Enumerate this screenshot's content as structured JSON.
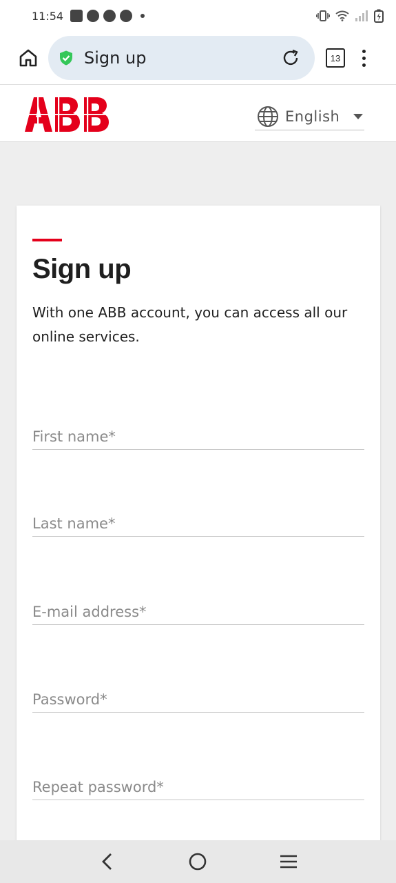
{
  "status_bar": {
    "time": "11:54",
    "icons": [
      "mail-icon",
      "speed-icon",
      "speed-icon",
      "speed-icon",
      "dot-icon",
      "vibrate-icon",
      "wifi-icon",
      "signal-icon",
      "battery-charging-icon"
    ]
  },
  "browser": {
    "tab_title": "Sign up",
    "tab_count": "13",
    "colors": {
      "url_bg": "#e3ebf3",
      "shield": "#34c759"
    }
  },
  "site": {
    "logo_alt": "ABB",
    "language": "English",
    "colors": {
      "brand_red": "#e4001b"
    }
  },
  "form": {
    "title": "Sign up",
    "intro": "With one ABB account, you can access all our online services.",
    "fields": [
      {
        "placeholder": "First name*"
      },
      {
        "placeholder": "Last name*"
      },
      {
        "placeholder": "E-mail address*"
      },
      {
        "placeholder": "Password*"
      },
      {
        "placeholder": "Repeat password*"
      }
    ]
  },
  "nav_bar": {
    "buttons": [
      "back-icon",
      "home-circle-icon",
      "recents-icon"
    ]
  }
}
